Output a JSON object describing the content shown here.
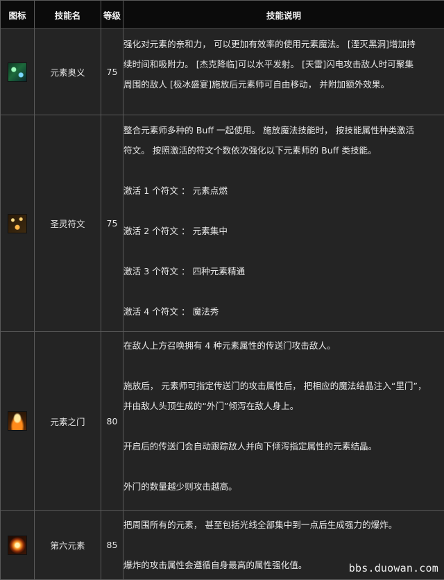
{
  "header": {
    "icon": "图标",
    "name": "技能名",
    "level": "等级",
    "description": "技能说明"
  },
  "skills": [
    {
      "icon": "element-mastery-icon",
      "name": "元素奥义",
      "level": "75",
      "lines": [
        "强化对元素的亲和力， 可以更加有效率的使用元素魔法。 [湮灭黑洞]增加持",
        "续时间和吸附力。 [杰克降临]可以水平发射。 [天雷]闪电攻击敌人时可聚集",
        "周围的敌人 [极冰盛宴]施放后元素师可自由移动， 并附加额外效果。"
      ]
    },
    {
      "icon": "holy-rune-icon",
      "name": "圣灵符文",
      "level": "75",
      "lines": [
        "整合元素师多种的 Buff 一起使用。 施放魔法技能时， 按技能属性种类激活",
        "符文。 按照激活的符文个数依次强化以下元素师的 Buff 类技能。",
        "",
        "激活 1 个符文 ： 元素点燃",
        "",
        "激活 2 个符文 ： 元素集中",
        "",
        "激活 3 个符文 ： 四种元素精通",
        "",
        "激活 4 个符文 ： 魔法秀"
      ]
    },
    {
      "icon": "element-gate-icon",
      "name": "元素之门",
      "level": "80",
      "lines": [
        "在敌人上方召唤拥有 4 种元素属性的传送门攻击敌人。",
        "",
        "施放后， 元素师可指定传送门的攻击属性后， 把相应的魔法结晶注入“里门”，",
        "并由敌人头顶生成的“外门”倾泻在敌人身上。",
        "",
        "开启后的传送门会自动跟踪敌人并向下倾泻指定属性的元素结晶。",
        "",
        "外门的数量越少则攻击越高。"
      ]
    },
    {
      "icon": "sixth-element-icon",
      "name": "第六元素",
      "level": "85",
      "lines": [
        "把周围所有的元素， 甚至包括光线全部集中到一点后生成强力的爆炸。",
        "",
        "爆炸的攻击属性会遵循自身最高的属性强化值。"
      ]
    }
  ],
  "watermark": "bbs.duowan.com"
}
